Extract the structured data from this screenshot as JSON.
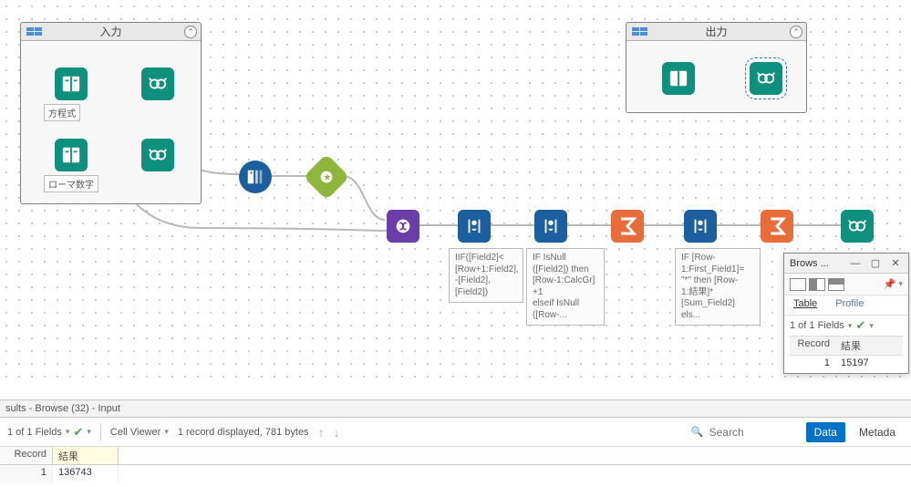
{
  "containers": {
    "input": {
      "title": "入力",
      "labels": {
        "equation": "方程式",
        "roman": "ローマ数字"
      }
    },
    "output": {
      "title": "出力"
    }
  },
  "annotations": {
    "formula1": "IIF([Field2]<\n[Row+1:Field2],\n-[Field2],\n[Field2])",
    "formula2": "IF IsNull\n([Field2]) then\n[Row-1:CalcGr]\n+1\nelseif IsNull\n([Row-...",
    "formula3": "IF [Row-\n1:First_Field1]=\n\"*\" then [Row-\n1:結果]*\n[Sum_Field2]\nels..."
  },
  "float_browse": {
    "title": "Brows ...",
    "tabs": {
      "table": "Table",
      "profile": "Profile"
    },
    "fields_dd": "1 of 1 Fields",
    "col_record": "Record",
    "col_value": "結果",
    "row1_rec": "1",
    "row1_val": "15197"
  },
  "results_header": "sults - Browse (32) - Input",
  "toolbar": {
    "fields_dd": "1 of 1 Fields",
    "cellviewer": "Cell Viewer",
    "status": "1 record displayed, 781 bytes",
    "search_placeholder": "Search",
    "btn_data": "Data",
    "btn_meta": "Metada"
  },
  "grid": {
    "col_record": "Record",
    "col_value": "結果",
    "row1_rec": "1",
    "row1_val": "136743"
  }
}
